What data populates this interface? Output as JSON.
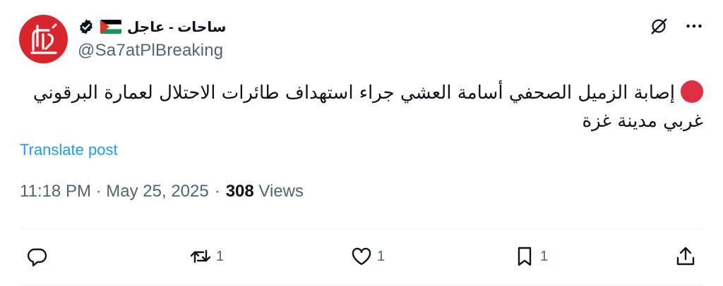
{
  "author": {
    "display_name": "ساحات - عاجل",
    "handle": "@Sa7atPlBreaking",
    "verified": true,
    "flag": "palestine-flag",
    "avatar_text": "ساحات"
  },
  "post": {
    "text": "إصابة الزميل الصحفي أسامة العشي جراء استهداف طائرات الاحتلال لعمارة البرقوني غربي مدينة غزة",
    "translate_label": "Translate post",
    "timestamp": "11:18 PM · May 25, 2025",
    "separator": "·",
    "views_count": "308",
    "views_label": "Views"
  },
  "actions": {
    "reply_count": "",
    "repost_count": "1",
    "like_count": "1",
    "bookmark_count": "1"
  },
  "colors": {
    "accent": "#1d9bf0",
    "secondary_text": "#536471",
    "avatar_bg": "#d9252e",
    "red_dot": "#dd2e44"
  }
}
